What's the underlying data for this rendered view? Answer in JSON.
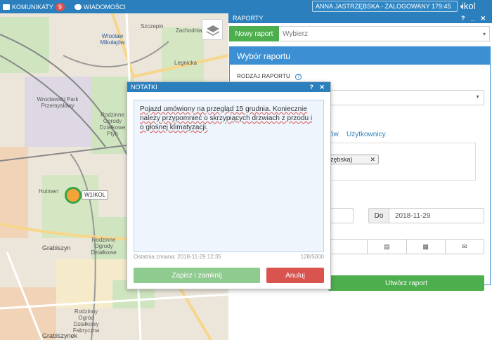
{
  "topbar": {
    "messages_label": "KOMUNIKATY",
    "messages_count": "9",
    "news_label": "WIADOMOŚCI",
    "user_status": "ANNA JASTRZĘBSKA - ZALOGOWANY 179:45",
    "logo": "ikol"
  },
  "map": {
    "labels": {
      "szczepin": "Szczepin",
      "wroclaw_mikolajow": "Wrocław Mikołajów",
      "park_przemyslowy": "Wrocławski Park Przemysłowy",
      "ogrody": "Rodzinne Ogrody Działkowe Ptyh",
      "hutmen": "Hutmen",
      "grabiszyn": "Grabiszyn",
      "grabiszynek": "Grabiszynek",
      "ogrody2": "Rodzinne Ogrody Działkowe",
      "ogrody3": "Rodzinny Ogród Działkowy Fabryczna",
      "legnicka": "Legnicka",
      "zachodnia": "Zachodnia"
    },
    "vehicle_tag": "W1IKOL",
    "icons": [
      "layers-icon",
      "vehicle-icon"
    ]
  },
  "panel": {
    "header": "RAPORTY",
    "header_controls": "? _ ✕",
    "new_report_button": "Nowy raport",
    "report_select": "Wybierz",
    "card_title": "Wybór raportu",
    "report_type_label": "RODZAJ RAPORTU",
    "tab_prev_fragment": "ów",
    "tab_users": "Użytkownicy",
    "user_tag": "rzębska)",
    "date_to_label": "Do",
    "date_to_value": "2018-11-29",
    "format_icons": [
      "",
      "pdf-icon",
      "xls-icon",
      "mail-icon"
    ],
    "create_button": "Utwórz raport"
  },
  "notes": {
    "title": "NOTATKI",
    "controls": "? ✕",
    "text_parts": [
      "Pojazd umówiony na przegląd 15 grudnia. Koniecznie należy przypomnieć o skrzypiących drzwiach z przodu i o głośnej klimatyzacji."
    ],
    "last_change": "Ostatnia zmiana: 2018-11-29 12:35",
    "char_count": "128/5000",
    "save_button": "Zapisz i zamknij",
    "cancel_button": "Anuluj"
  }
}
